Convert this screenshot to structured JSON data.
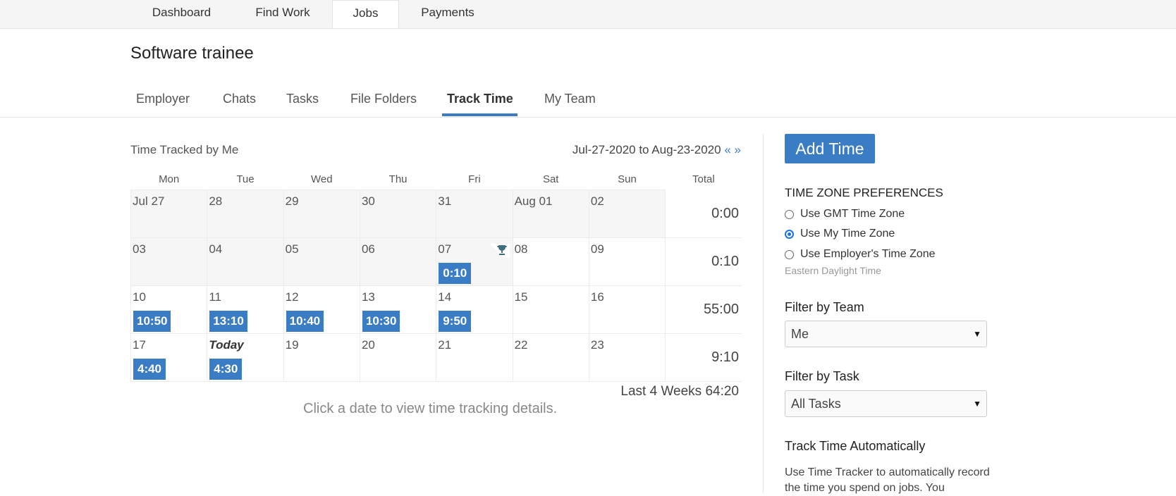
{
  "topnav": {
    "tabs": [
      {
        "label": "Dashboard"
      },
      {
        "label": "Find Work"
      },
      {
        "label": "Jobs"
      },
      {
        "label": "Payments"
      }
    ],
    "active": "Jobs"
  },
  "page": {
    "title": "Software trainee"
  },
  "subnav": {
    "tabs": [
      {
        "label": "Employer"
      },
      {
        "label": "Chats"
      },
      {
        "label": "Tasks"
      },
      {
        "label": "File Folders"
      },
      {
        "label": "Track Time"
      },
      {
        "label": "My Team"
      }
    ],
    "active": "Track Time"
  },
  "tracker": {
    "heading": "Time Tracked by Me",
    "range": "Jul-27-2020 to Aug-23-2020",
    "prev": "«",
    "next": "»",
    "columns": [
      "Mon",
      "Tue",
      "Wed",
      "Thu",
      "Fri",
      "Sat",
      "Sun",
      "Total"
    ],
    "weeks": [
      {
        "days": [
          {
            "label": "Jul 27",
            "time": ""
          },
          {
            "label": "28",
            "time": ""
          },
          {
            "label": "29",
            "time": ""
          },
          {
            "label": "30",
            "time": ""
          },
          {
            "label": "31",
            "time": ""
          },
          {
            "label": "Aug 01",
            "time": ""
          },
          {
            "label": "02",
            "time": ""
          }
        ],
        "total": "0:00"
      },
      {
        "days": [
          {
            "label": "03",
            "time": ""
          },
          {
            "label": "04",
            "time": ""
          },
          {
            "label": "05",
            "time": ""
          },
          {
            "label": "06",
            "time": ""
          },
          {
            "label": "07",
            "time": "0:10"
          },
          {
            "label": "08",
            "time": ""
          },
          {
            "label": "09",
            "time": ""
          }
        ],
        "total": "0:10"
      },
      {
        "days": [
          {
            "label": "10",
            "time": "10:50"
          },
          {
            "label": "11",
            "time": "13:10"
          },
          {
            "label": "12",
            "time": "10:40"
          },
          {
            "label": "13",
            "time": "10:30"
          },
          {
            "label": "14",
            "time": "9:50"
          },
          {
            "label": "15",
            "time": ""
          },
          {
            "label": "16",
            "time": ""
          }
        ],
        "total": "55:00"
      },
      {
        "days": [
          {
            "label": "17",
            "time": "4:40"
          },
          {
            "label": "Today",
            "time": "4:30"
          },
          {
            "label": "19",
            "time": ""
          },
          {
            "label": "20",
            "time": ""
          },
          {
            "label": "21",
            "time": ""
          },
          {
            "label": "22",
            "time": ""
          },
          {
            "label": "23",
            "time": ""
          }
        ],
        "total": "9:10"
      }
    ],
    "last4": "Last 4 Weeks 64:20",
    "hint": "Click a date to view time tracking details."
  },
  "sidebar": {
    "add_time": "Add Time",
    "tz_heading": "TIME ZONE PREFERENCES",
    "tz_options": [
      {
        "label": "Use GMT Time Zone",
        "checked": false
      },
      {
        "label": "Use My Time Zone",
        "checked": true
      },
      {
        "label": "Use Employer's Time Zone",
        "checked": false
      }
    ],
    "tz_note": "Eastern Daylight Time",
    "team_heading": "Filter by Team",
    "team_value": "Me",
    "task_heading": "Filter by Task",
    "task_value": "All Tasks",
    "auto_heading": "Track Time Automatically",
    "auto_desc": "Use Time Tracker to automatically record the time you spend on jobs. You"
  },
  "colors": {
    "accent": "#3b7dc4"
  }
}
